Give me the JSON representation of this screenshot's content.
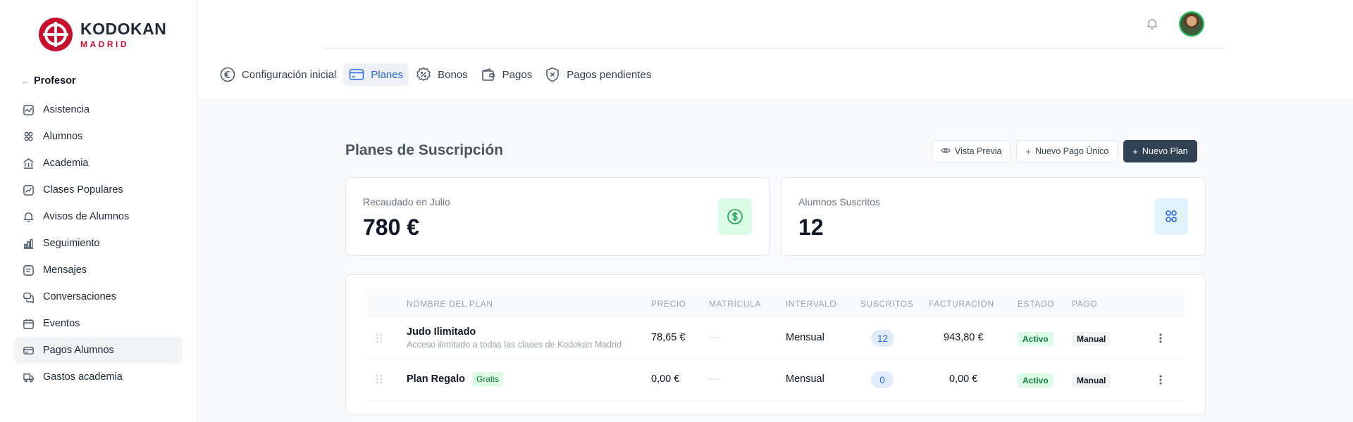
{
  "logo": {
    "line1": "KODOKAN",
    "line2": "MADRID"
  },
  "sidebar": {
    "back_label": "Profesor",
    "items": [
      {
        "label": "Asistencia",
        "icon": "activity-icon"
      },
      {
        "label": "Alumnos",
        "icon": "users-icon"
      },
      {
        "label": "Academia",
        "icon": "building-icon"
      },
      {
        "label": "Clases Populares",
        "icon": "trend-icon"
      },
      {
        "label": "Avisos de Alumnos",
        "icon": "bell-icon"
      },
      {
        "label": "Seguimiento",
        "icon": "bar-chart-icon"
      },
      {
        "label": "Mensajes",
        "icon": "message-icon"
      },
      {
        "label": "Conversaciones",
        "icon": "chat-icon"
      },
      {
        "label": "Eventos",
        "icon": "calendar-icon"
      },
      {
        "label": "Pagos Alumnos",
        "icon": "card-icon",
        "active": true
      },
      {
        "label": "Gastos academia",
        "icon": "truck-icon"
      }
    ]
  },
  "tabs": [
    {
      "label": "Configuración inicial",
      "icon": "euro-icon"
    },
    {
      "label": "Planes",
      "icon": "card-icon",
      "active": true
    },
    {
      "label": "Bonos",
      "icon": "percent-badge-icon"
    },
    {
      "label": "Pagos",
      "icon": "wallet-icon"
    },
    {
      "label": "Pagos pendientes",
      "icon": "shield-x-icon"
    }
  ],
  "page": {
    "title": "Planes de Suscripción",
    "buttons": {
      "preview": "Vista Previa",
      "one_time": "Nuevo Pago Único",
      "new_plan": "Nuevo Plan"
    }
  },
  "stats": [
    {
      "label": "Recaudado en Julio",
      "value": "780 €",
      "icon": "dollar-circle-icon",
      "color": "#16a34a",
      "bg": "#dcfce7"
    },
    {
      "label": "Alumnos Suscritos",
      "value": "12",
      "icon": "users-icon",
      "color": "#2563eb",
      "bg": "#e0f2fe"
    }
  ],
  "table": {
    "headers": [
      "NOMBRE DEL PLAN",
      "PRECIO",
      "MATRÍCULA",
      "INTERVALO",
      "SUSCRITOS",
      "FACTURACIÓN",
      "ESTADO",
      "PAGO"
    ],
    "rows": [
      {
        "name": "Judo Ilimitado",
        "desc": "Acceso ilimitado a todas las clases de Kodokan Madrid",
        "badge": "",
        "price": "78,65 €",
        "enrollment": "—",
        "interval": "Mensual",
        "subscribers": "12",
        "billing": "943,80 €",
        "status": "Activo",
        "payment": "Manual"
      },
      {
        "name": "Plan Regalo",
        "desc": "",
        "badge": "Gratis",
        "price": "0,00 €",
        "enrollment": "—",
        "interval": "Mensual",
        "subscribers": "0",
        "billing": "0,00 €",
        "status": "Activo",
        "payment": "Manual"
      }
    ]
  }
}
